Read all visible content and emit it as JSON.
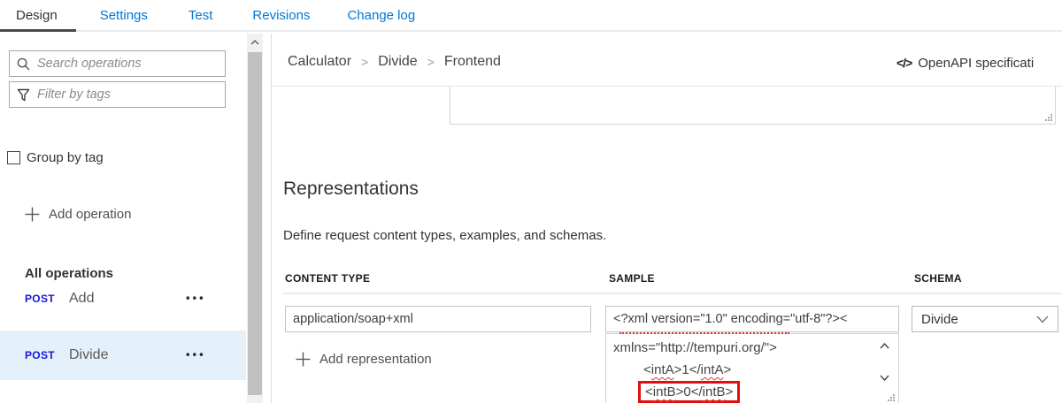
{
  "tabs": [
    {
      "label": "Design",
      "active": true
    },
    {
      "label": "Settings",
      "active": false
    },
    {
      "label": "Test",
      "active": false
    },
    {
      "label": "Revisions",
      "active": false
    },
    {
      "label": "Change log",
      "active": false
    }
  ],
  "sidebar": {
    "search_placeholder": "Search operations",
    "filter_placeholder": "Filter by tags",
    "group_by_tag_label": "Group by tag",
    "add_operation_label": "Add operation",
    "all_operations_label": "All operations",
    "operations": [
      {
        "method": "POST",
        "name": "Add",
        "selected": false
      },
      {
        "method": "POST",
        "name": "Divide",
        "selected": true
      }
    ],
    "more_glyph": "•••"
  },
  "main": {
    "breadcrumb": {
      "items": [
        "Calculator",
        "Divide",
        "Frontend"
      ],
      "separator": ">"
    },
    "openapi": {
      "icon_glyph": "</>",
      "label": "OpenAPI specificati"
    },
    "representations": {
      "title": "Representations",
      "description": "Define request content types, examples, and schemas.",
      "columns": [
        "CONTENT TYPE",
        "SAMPLE",
        "SCHEMA"
      ],
      "row": {
        "content_type": "application/soap+xml",
        "sample_line1": "<?xml version=\"1.0\" encoding=\"utf-8\"?><",
        "schema": "Divide"
      },
      "sample_expanded": {
        "line1": "xmlns=\"http://tempuri.org/\">",
        "line2_p1": "<",
        "line2_w1": "intA",
        "line2_p2": ">1</",
        "line2_w2": "intA",
        "line2_p3": ">",
        "line3_p1": "<",
        "line3_w1": "intB",
        "line3_p2": ">0</",
        "line3_w2": "intB",
        "line3_p3": ">"
      },
      "add_representation_label": "Add representation"
    }
  },
  "colors": {
    "tab_link": "#0078d4",
    "active_tab_underline": "#4a4a4a",
    "post_method": "#1717d6",
    "selected_row_bg": "#e4f1fb",
    "annotation_red": "#dd1111",
    "squiggle_red": "#e03a30"
  }
}
